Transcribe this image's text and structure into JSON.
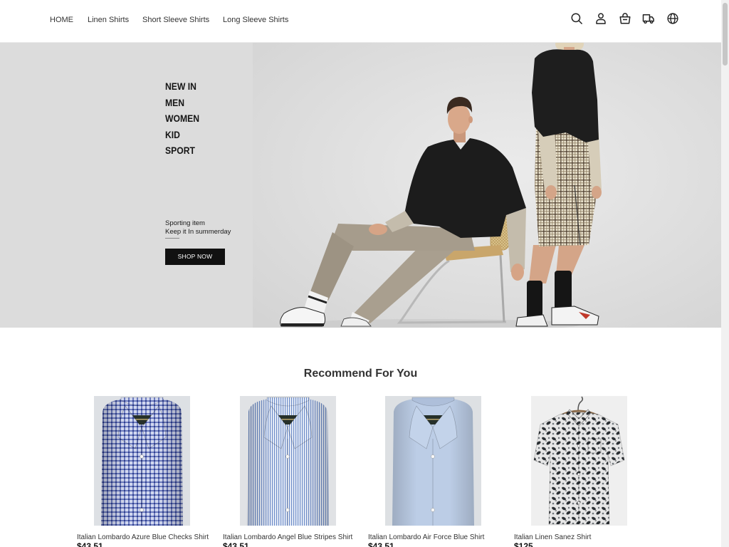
{
  "nav": {
    "links": [
      "HOME",
      "Linen Shirts",
      "Short Sleeve Shirts",
      "Long Sleeve Shirts"
    ],
    "icons": [
      "search-icon",
      "user-icon",
      "shopping-bag-icon",
      "truck-icon",
      "globe-icon"
    ]
  },
  "hero": {
    "menu": [
      "NEW IN",
      "MEN",
      "WOMEN",
      "KID",
      "SPORT"
    ],
    "tagline_1": "Sporting item",
    "tagline_2": "Keep it In summerday",
    "cta_label": "SHOP NOW"
  },
  "recommend": {
    "heading": "Recommend For You",
    "products": [
      {
        "title": "Italian Lombardo Azure Blue Checks Shirt",
        "price": "$43.51"
      },
      {
        "title": "Italian Lombardo Angel Blue Stripes Shirt",
        "price": "$43.51"
      },
      {
        "title": "Italian Lombardo Air Force Blue Shirt",
        "price": "$43.51"
      },
      {
        "title": "Italian Linen Sanez Shirt",
        "price": "$125"
      }
    ]
  },
  "colors": {
    "text": "#333333",
    "cta_background": "#111111",
    "hero_background": "#dcdcdc"
  }
}
